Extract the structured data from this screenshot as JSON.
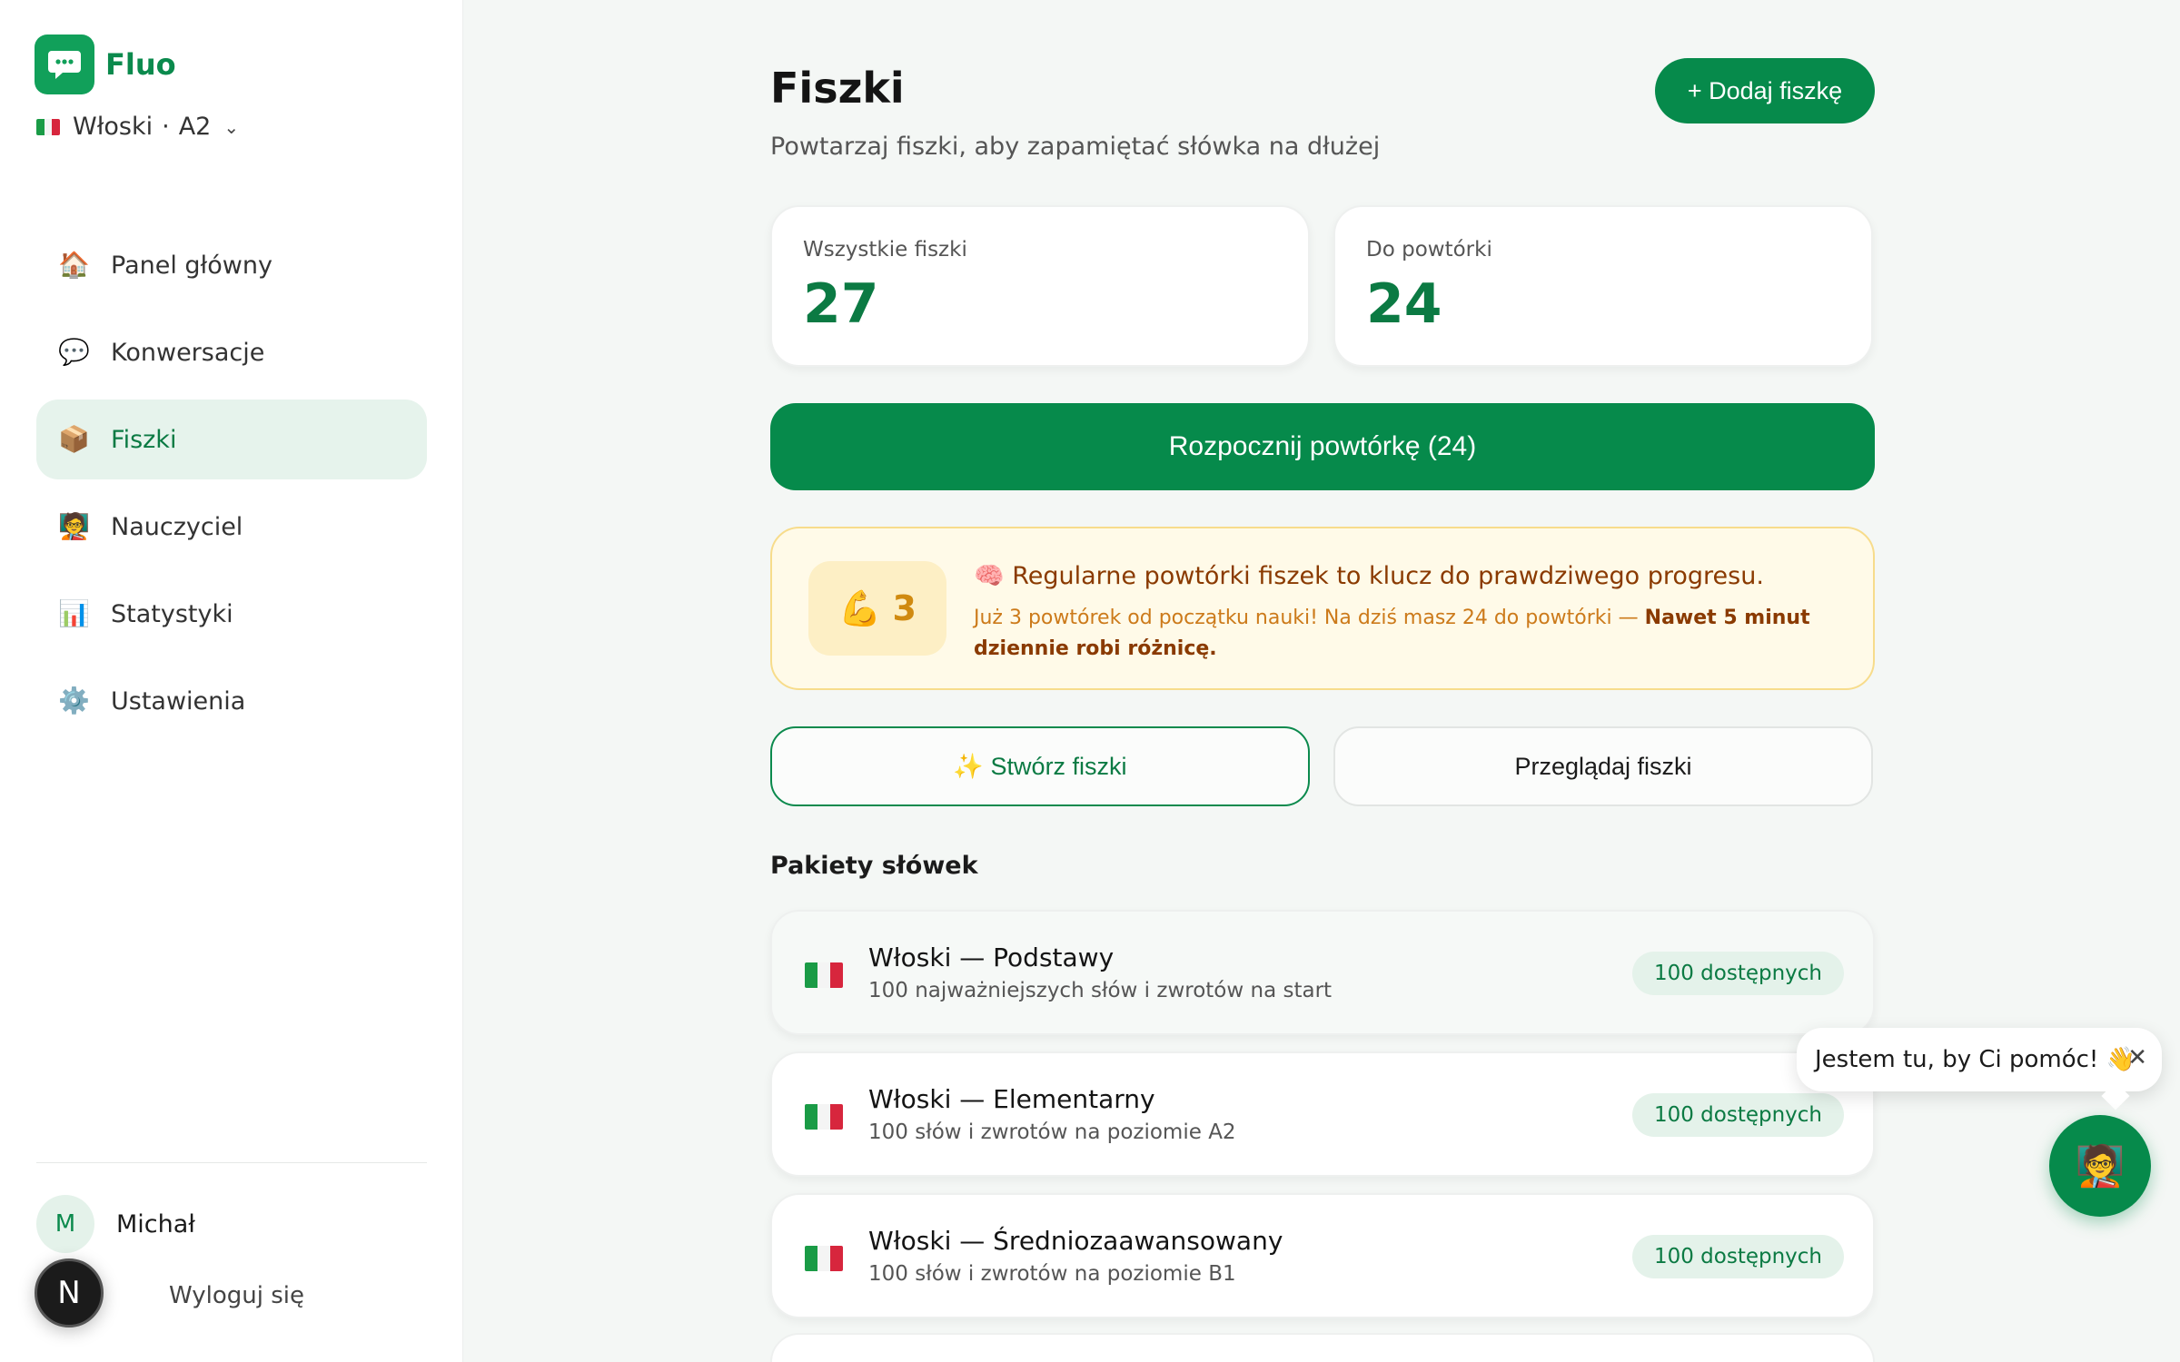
{
  "brand": {
    "name": "Fluo",
    "logo_icon": "chat-bubble-icon",
    "color": "#11a05a"
  },
  "language": {
    "flag": "italy-flag-icon",
    "name": "Włoski",
    "separator": "·",
    "level": "A2"
  },
  "nav": [
    {
      "icon": "🏠",
      "label": "Panel główny",
      "active": false
    },
    {
      "icon": "💬",
      "label": "Konwersacje",
      "active": false
    },
    {
      "icon": "📦",
      "label": "Fiszki",
      "active": true
    },
    {
      "icon": "🧑‍🏫",
      "label": "Nauczyciel",
      "active": false
    },
    {
      "icon": "📊",
      "label": "Statystyki",
      "active": false
    },
    {
      "icon": "⚙️",
      "label": "Ustawienia",
      "active": false
    }
  ],
  "user": {
    "initial": "M",
    "name": "Michał",
    "logout": "Wyloguj się",
    "dev_badge": "N"
  },
  "page": {
    "title": "Fiszki",
    "subtitle": "Powtarzaj fiszki, aby zapamiętać słówka na dłużej",
    "add_button": "+ Dodaj fiszkę"
  },
  "stats": [
    {
      "label": "Wszystkie fiszki",
      "value": "27"
    },
    {
      "label": "Do powtórki",
      "value": "24"
    }
  ],
  "start_button": "Rozpocznij powtórkę (24)",
  "tip": {
    "streak_icon": "💪",
    "streak": "3",
    "title": "🧠 Regularne powtórki fiszek to klucz do prawdziwego progresu.",
    "body": "Już 3 powtórek od początku nauki! Na dziś masz 24 do powtórki — ",
    "body_bold": "Nawet 5 minut dziennie robi różnicę."
  },
  "actions": {
    "create": "✨ Stwórz fiszki",
    "browse": "Przeglądaj fiszki"
  },
  "packs_title": "Pakiety słówek",
  "packs": [
    {
      "title": "Włoski — Podstawy",
      "desc": "100 najważniejszych słów i zwrotów na start",
      "badge": "100 dostępnych"
    },
    {
      "title": "Włoski — Elementarny",
      "desc": "100 słów i zwrotów na poziomie A2",
      "badge": "100 dostępnych"
    },
    {
      "title": "Włoski — Średniozaawansowany",
      "desc": "100 słów i zwrotów na poziomie B1",
      "badge": "100 dostępnych"
    }
  ],
  "helper": {
    "message": "Jestem tu, by Ci pomóc! 👋",
    "close": "✕",
    "fab_icon": "🧑‍🏫"
  },
  "colors": {
    "primary": "#068a4b",
    "active_bg": "#e6f3ec",
    "tip_bg": "#fffae8"
  }
}
